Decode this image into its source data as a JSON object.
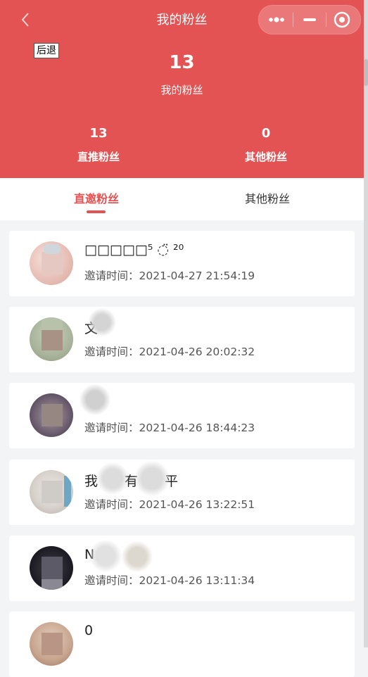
{
  "nav": {
    "title": "我的粉丝",
    "back_tooltip": "后退"
  },
  "stats": {
    "total_count": "13",
    "total_label": "我的粉丝",
    "direct_count": "13",
    "direct_label": "直推粉丝",
    "other_count": "0",
    "other_label": "其他粉丝"
  },
  "tabs": [
    {
      "label": "直邀粉丝",
      "active": true
    },
    {
      "label": "其他粉丝",
      "active": false
    }
  ],
  "colors": {
    "accent": "#e45353"
  },
  "fans": [
    {
      "name": "□□□□□⁵ ◌̈ ²⁰",
      "time_label": "邀请时间：",
      "time": "2021-04-27 21:54:19"
    },
    {
      "name": "文",
      "time_label": "邀请时间：",
      "time": "2021-04-26 20:02:32"
    },
    {
      "name": "",
      "time_label": "邀请时间：",
      "time": "2021-04-26 18:44:23"
    },
    {
      "name": "我　　有　　平",
      "time_label": "邀请时间：",
      "time": "2021-04-26 13:22:51"
    },
    {
      "name": "N",
      "time_label": "邀请时间：",
      "time": "2021-04-26 13:11:34"
    },
    {
      "name": "0",
      "time_label": "",
      "time": ""
    }
  ]
}
